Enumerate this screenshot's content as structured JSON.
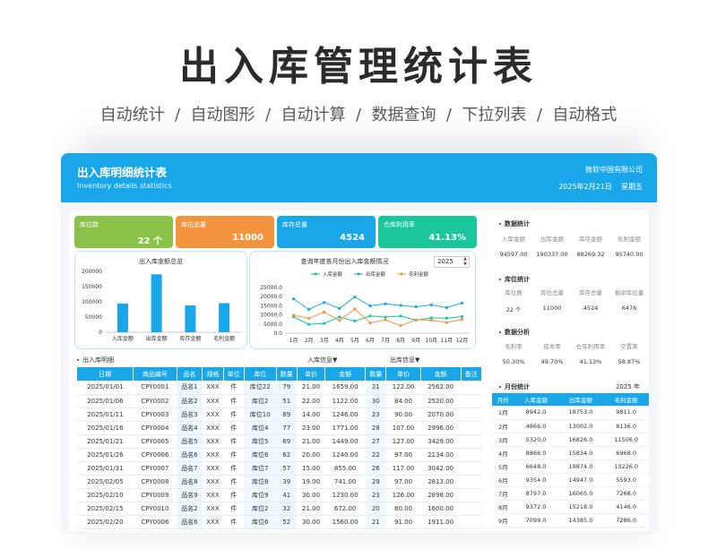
{
  "page": {
    "title": "出入库管理统计表",
    "subtitle": "自动统计  /  自动图形  /  自动计算  /  数据查询  /  下拉列表  /  自动格式"
  },
  "header": {
    "title": "出入库明细统计表",
    "subtitle": "Inventory details statistics",
    "company": "微软中国有限公司",
    "date": "2025年2月21日    星期五"
  },
  "kpis": [
    {
      "label": "库位数",
      "value": "22 个",
      "color": "#8bc34a"
    },
    {
      "label": "库位总量",
      "value": "11000",
      "color": "#f4943f"
    },
    {
      "label": "库存总量",
      "value": "4524",
      "color": "#1aa7ea"
    },
    {
      "label": "仓库利用率",
      "value": "41.13%",
      "color": "#19c79a"
    }
  ],
  "chart_data": [
    {
      "type": "bar",
      "title": "出入库金额总览",
      "categories": [
        "入库金额",
        "出库金额",
        "库存金额",
        "毛利金额"
      ],
      "values": [
        94597,
        190337,
        88269.32,
        95740
      ],
      "ylim": [
        0,
        200000
      ],
      "yticks": [
        "200000",
        "150000",
        "100000",
        "50000",
        "0"
      ],
      "color": "#1aa7ea"
    },
    {
      "type": "line",
      "title": "查询年度各月份出入库金额情况",
      "categories": [
        "1月",
        "2月",
        "3月",
        "4月",
        "5月",
        "6月",
        "7月",
        "8月",
        "9月",
        "10月",
        "11月",
        "12月"
      ],
      "ylim": [
        0,
        25000
      ],
      "yticks": [
        "25000.0",
        "20000.0",
        "15000.0",
        "10000.0",
        "5000.0",
        "0.0"
      ],
      "series": [
        {
          "name": "入库金额",
          "color": "#19c79a",
          "values": [
            8942,
            4866,
            5320,
            8866,
            6648,
            9354,
            8797,
            9372,
            7099,
            8400,
            8200,
            9000
          ]
        },
        {
          "name": "出库金额",
          "color": "#1aa7ea",
          "values": [
            18753,
            13002,
            16826,
            13518,
            19874,
            14947,
            16065,
            15218,
            14385,
            15500,
            14000,
            16500
          ]
        },
        {
          "name": "毛利金额",
          "color": "#f4943f",
          "values": [
            9811,
            8136,
            11506,
            6968,
            13226,
            5593,
            7268,
            4146,
            7286,
            7100,
            5800,
            7500
          ]
        }
      ]
    }
  ],
  "year_selector": {
    "value": "2025"
  },
  "detail": {
    "label": "出入库明细",
    "in_group": "入库信息▼",
    "out_group": "出库信息▼",
    "columns": [
      "日期",
      "商品编号",
      "品名",
      "规格",
      "单位",
      "库位",
      "数量",
      "单价",
      "金额",
      "数量",
      "单价",
      "金额",
      "备注"
    ],
    "rows": [
      [
        "2025/01/01",
        "CPY0001",
        "品名1",
        "XXX",
        "件",
        "库位22",
        "79",
        "21.00",
        "1659.00",
        "21",
        "122.00",
        "2562.00",
        ""
      ],
      [
        "2025/01/06",
        "CPY0002",
        "品名2",
        "XXX",
        "件",
        "库位2",
        "51",
        "22.00",
        "1122.00",
        "30",
        "84.00",
        "2520.00",
        ""
      ],
      [
        "2025/01/11",
        "CPY0003",
        "品名3",
        "XXX",
        "件",
        "库位10",
        "89",
        "14.00",
        "1246.00",
        "23",
        "90.00",
        "2070.00",
        ""
      ],
      [
        "2025/01/16",
        "CPY0004",
        "品名4",
        "XXX",
        "件",
        "库位4",
        "77",
        "23.00",
        "1771.00",
        "28",
        "107.00",
        "2996.00",
        ""
      ],
      [
        "2025/01/21",
        "CPY0005",
        "品名5",
        "XXX",
        "件",
        "库位5",
        "69",
        "21.00",
        "1449.00",
        "27",
        "127.00",
        "3429.00",
        ""
      ],
      [
        "2025/01/26",
        "CPY0006",
        "品名6",
        "XXX",
        "件",
        "库位6",
        "62",
        "20.00",
        "1240.00",
        "22",
        "97.00",
        "2134.00",
        ""
      ],
      [
        "2025/01/31",
        "CPY0007",
        "品名7",
        "XXX",
        "件",
        "库位7",
        "57",
        "15.00",
        "855.00",
        "26",
        "117.00",
        "3042.00",
        ""
      ],
      [
        "2025/02/05",
        "CPY0008",
        "品名8",
        "XXX",
        "件",
        "库位8",
        "39",
        "19.00",
        "741.00",
        "29",
        "97.00",
        "2813.00",
        ""
      ],
      [
        "2025/02/10",
        "CPY0009",
        "品名9",
        "XXX",
        "件",
        "库位9",
        "41",
        "30.00",
        "1230.00",
        "23",
        "126.00",
        "2898.00",
        ""
      ],
      [
        "2025/02/15",
        "CPY0010",
        "品名2",
        "XXX",
        "件",
        "库位2",
        "32",
        "21.00",
        "672.00",
        "20",
        "80.00",
        "1600.00",
        ""
      ],
      [
        "2025/02/20",
        "CPY0006",
        "品名6",
        "XXX",
        "件",
        "库位6",
        "52",
        "30.00",
        "1560.00",
        "21",
        "91.00",
        "1911.00",
        ""
      ]
    ]
  },
  "stats": {
    "data": {
      "title": "数据统计",
      "labels": [
        "入库金额",
        "出库金额",
        "库存金额",
        "毛利金额"
      ],
      "values": [
        "94597.00",
        "190337.00",
        "88269.32",
        "95740.00"
      ]
    },
    "location": {
      "title": "库位统计",
      "labels": [
        "库位数",
        "库位总量",
        "库存总量",
        "剩余库位量"
      ],
      "values": [
        "22 个",
        "11000",
        "4524",
        "6476"
      ]
    },
    "analysis": {
      "title": "数据分析",
      "labels": [
        "毛利率",
        "成本率",
        "仓库利用率",
        "空置率"
      ],
      "values": [
        "50.30%",
        "49.70%",
        "41.13%",
        "58.87%"
      ]
    }
  },
  "monthly": {
    "title": "月份统计",
    "year": "2025 年",
    "columns": [
      "月份",
      "入库金额",
      "出库金额",
      "毛利金额"
    ],
    "rows": [
      [
        "1月",
        "8942.0",
        "18753.0",
        "9811.0"
      ],
      [
        "2月",
        "4866.0",
        "13002.0",
        "8136.0"
      ],
      [
        "3月",
        "5320.0",
        "16826.0",
        "11506.0"
      ],
      [
        "4月",
        "8866.0",
        "15834.0",
        "6968.0"
      ],
      [
        "5月",
        "6648.0",
        "19874.0",
        "13226.0"
      ],
      [
        "6月",
        "9354.0",
        "14947.0",
        "5593.0"
      ],
      [
        "7月",
        "8797.0",
        "16065.0",
        "7268.0"
      ],
      [
        "8月",
        "9372.0",
        "15218.0",
        "4146.0"
      ],
      [
        "9月",
        "7099.0",
        "14385.0",
        "7286.0"
      ]
    ]
  }
}
